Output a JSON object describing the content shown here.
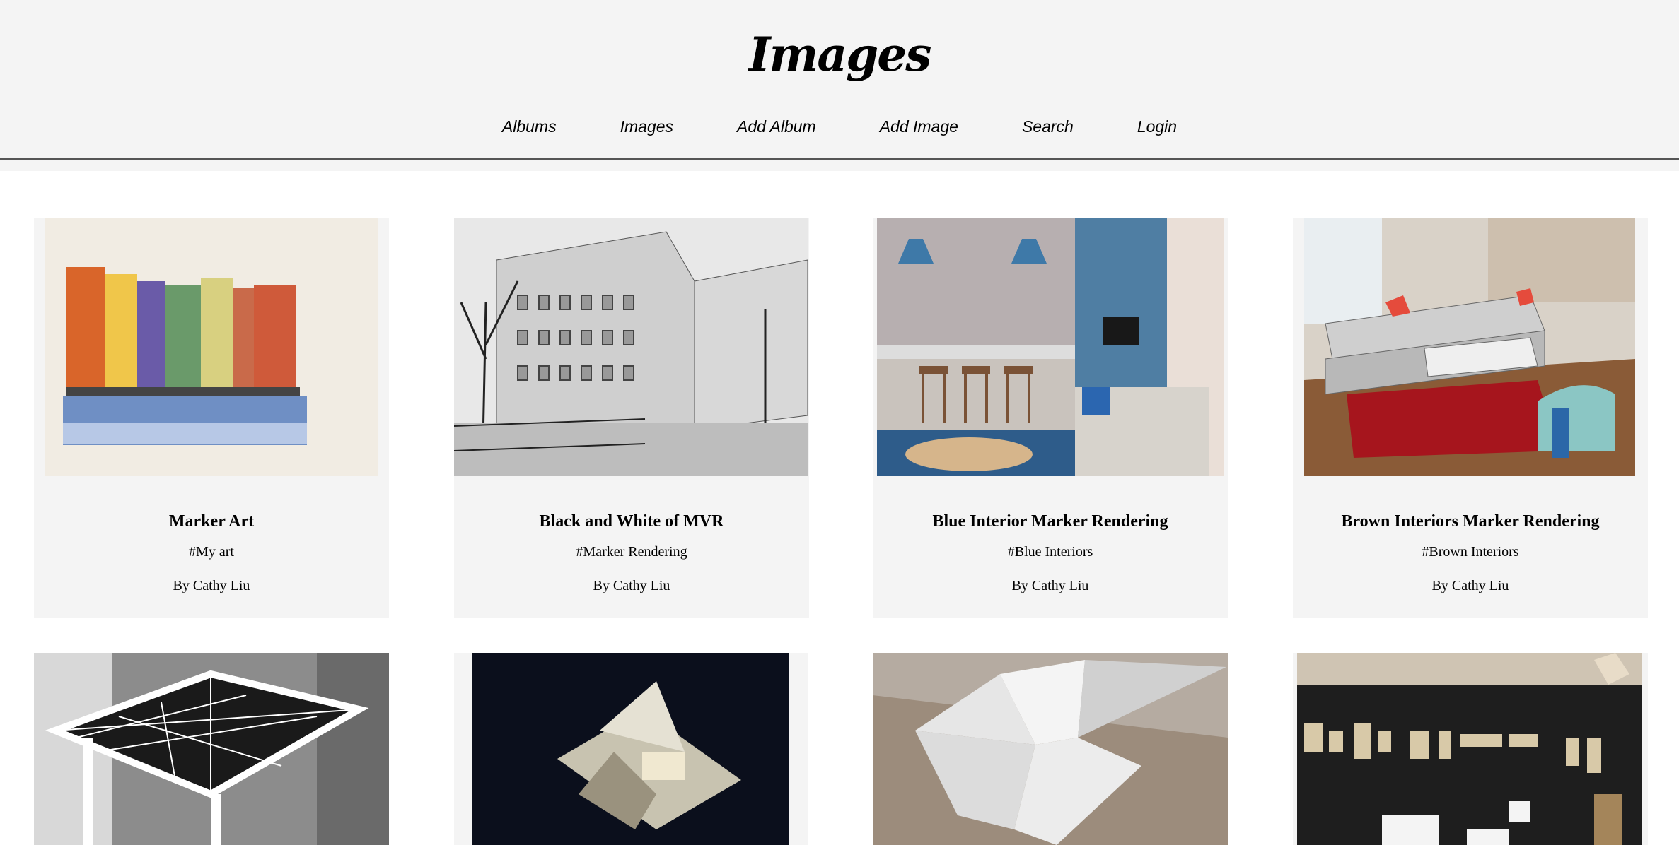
{
  "site": {
    "title": "Images"
  },
  "nav": {
    "items": [
      {
        "label": "Albums"
      },
      {
        "label": "Images"
      },
      {
        "label": "Add Album"
      },
      {
        "label": "Add Image"
      },
      {
        "label": "Search"
      },
      {
        "label": "Login"
      }
    ]
  },
  "cards": [
    {
      "title": "Marker Art",
      "tag": "#My art",
      "author": "By Cathy Liu"
    },
    {
      "title": "Black and White of MVR",
      "tag": "#Marker Rendering",
      "author": "By Cathy Liu"
    },
    {
      "title": "Blue Interior Marker Rendering",
      "tag": "#Blue Interiors",
      "author": "By Cathy Liu"
    },
    {
      "title": "Brown Interiors Marker Rendering",
      "tag": "#Brown Interiors",
      "author": "By Cathy Liu"
    }
  ]
}
